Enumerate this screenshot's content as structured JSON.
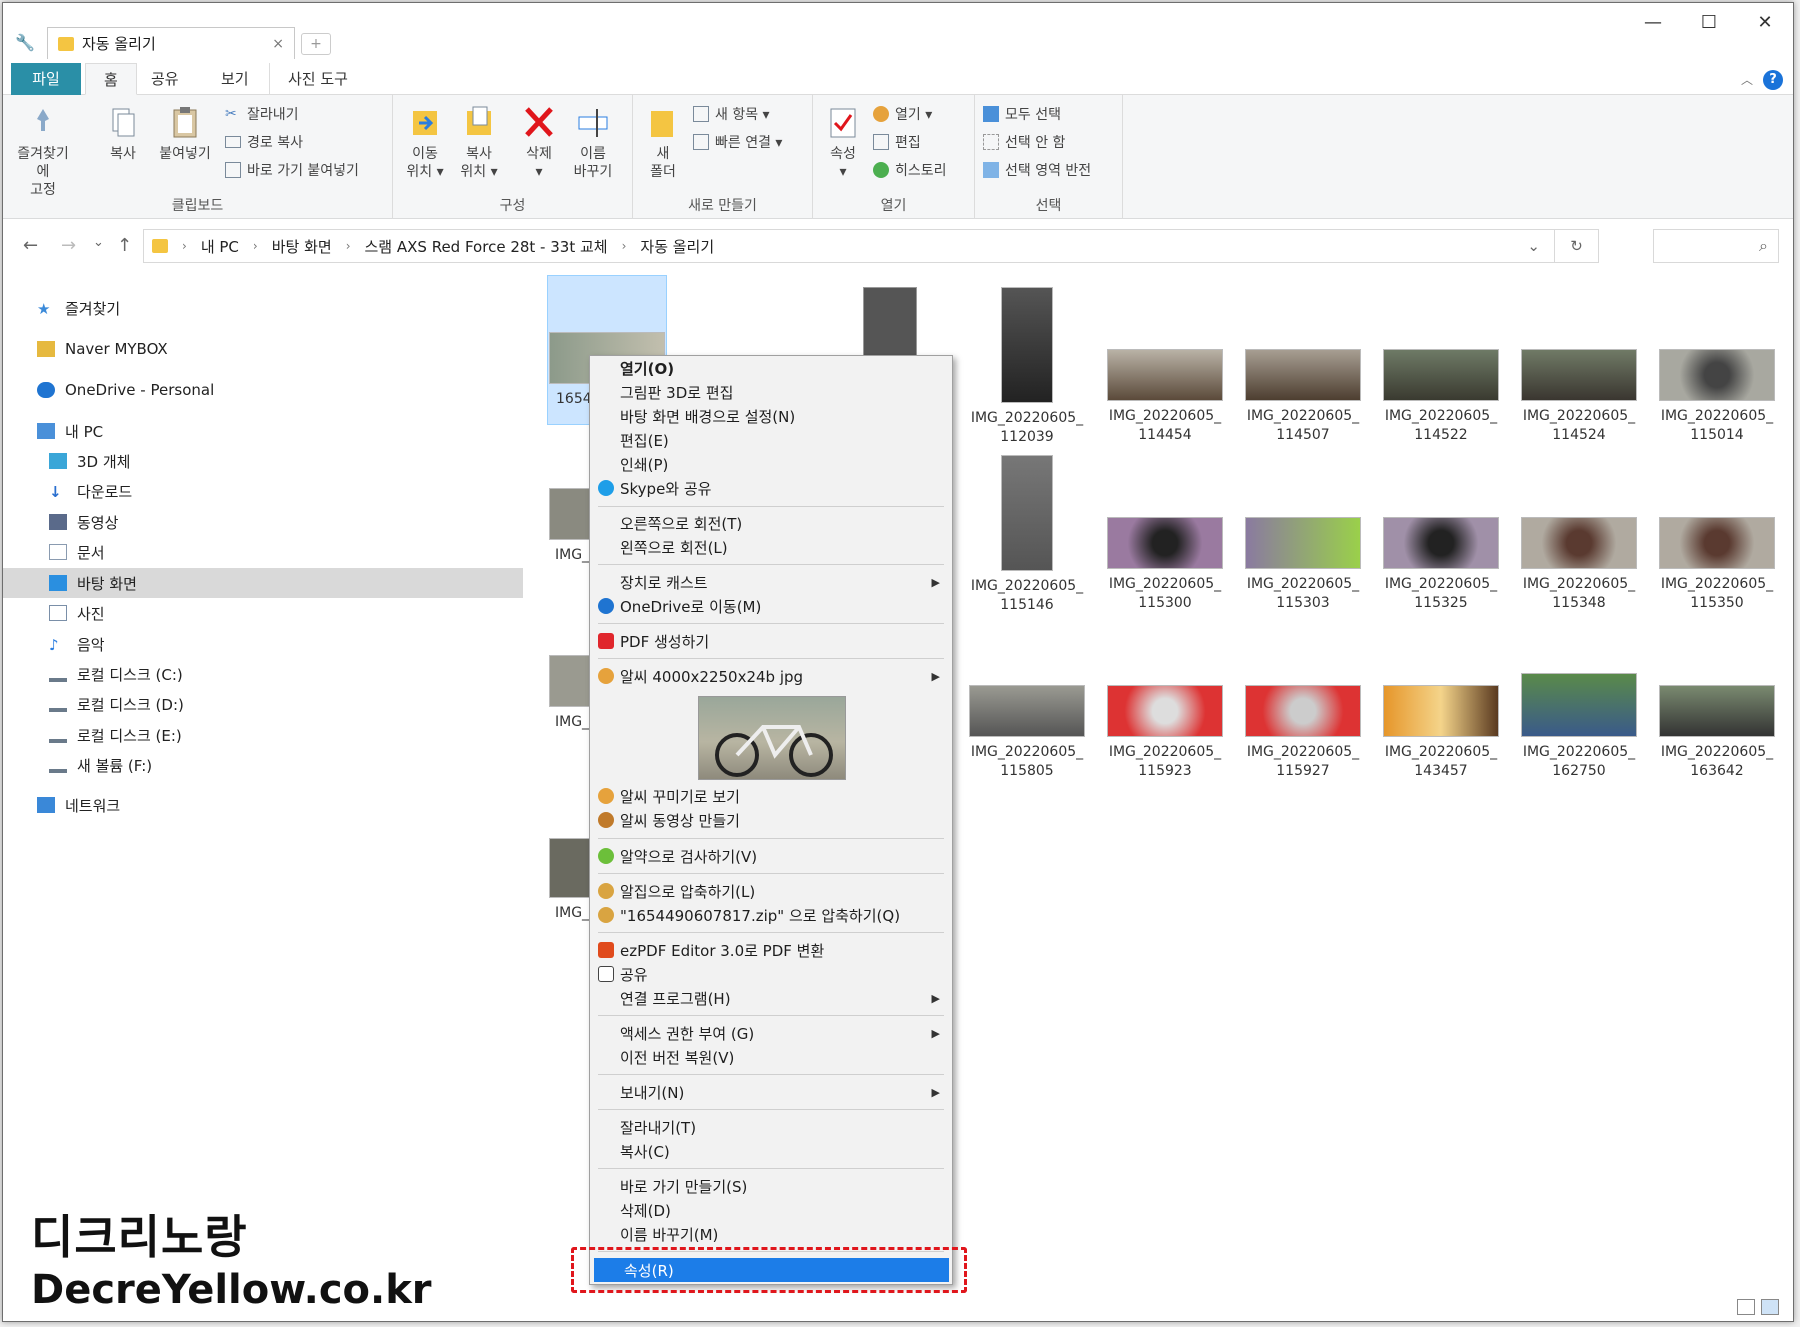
{
  "window": {
    "tab_title": "자동 올리기",
    "controls": {
      "minimize": "—",
      "maximize": "☐",
      "close": "✕"
    }
  },
  "menubar": {
    "tabs": [
      "파일",
      "홈",
      "공유",
      "보기",
      "사진 도구"
    ],
    "help": "?"
  },
  "ribbon": {
    "clipboard": {
      "label": "클립보드",
      "pin_line1": "즐겨찾기에",
      "pin_line2": "고정",
      "copy": "복사",
      "paste": "붙여넣기",
      "cut": "잘라내기",
      "copy_path": "경로 복사",
      "paste_shortcut": "바로 가기 붙여넣기"
    },
    "organize": {
      "label": "구성",
      "move_line1": "이동",
      "move_line2": "위치 ▾",
      "copyto_line1": "복사",
      "copyto_line2": "위치 ▾",
      "delete": "삭제",
      "delete_arrow": "▾",
      "rename_line1": "이름",
      "rename_line2": "바꾸기"
    },
    "new": {
      "label": "새로 만들기",
      "folder_line1": "새",
      "folder_line2": "폴더",
      "new_item": "새 항목 ▾",
      "easy_access": "빠른 연결 ▾"
    },
    "open": {
      "label": "열기",
      "properties": "속성",
      "properties_arrow": "▾",
      "open": "열기 ▾",
      "edit": "편집",
      "history": "히스토리"
    },
    "select": {
      "label": "선택",
      "select_all": "모두 선택",
      "select_none": "선택 안 함",
      "invert": "선택 영역 반전"
    }
  },
  "address": {
    "crumbs": [
      "내 PC",
      "바탕 화면",
      "스램 AXS Red Force 28t - 33t 교체",
      "자동 올리기"
    ],
    "back": "←",
    "forward": "→",
    "recent": "⌄",
    "up": "↑",
    "dropdown": "⌄",
    "refresh": "↻",
    "search_icon": "⌕"
  },
  "nav": {
    "items": [
      {
        "label": "즐겨찾기",
        "icon": "star-icon",
        "color": "#3b8ad9"
      },
      {
        "label": "Naver MYBOX",
        "icon": "mybox-icon",
        "color": "#e6b93f"
      },
      {
        "label": "OneDrive - Personal",
        "icon": "cloud-icon",
        "color": "#1f74d1"
      },
      {
        "label": "내 PC",
        "icon": "pc-icon",
        "color": "#4a90d9"
      },
      {
        "label": "3D 개체",
        "icon": "cube-icon",
        "color": "#3aa6d8"
      },
      {
        "label": "다운로드",
        "icon": "download-icon",
        "color": "#2a6fcf"
      },
      {
        "label": "동영상",
        "icon": "video-icon",
        "color": "#5a6a8a"
      },
      {
        "label": "문서",
        "icon": "document-icon",
        "color": "#8a9bb0"
      },
      {
        "label": "바탕 화면",
        "icon": "desktop-icon",
        "color": "#2a8fe0"
      },
      {
        "label": "사진",
        "icon": "picture-icon",
        "color": "#7a8fa8"
      },
      {
        "label": "음악",
        "icon": "music-icon",
        "color": "#2a7de0"
      },
      {
        "label": "로컬 디스크 (C:)",
        "icon": "drive-icon",
        "color": "#6a7a8a"
      },
      {
        "label": "로컬 디스크 (D:)",
        "icon": "drive-icon",
        "color": "#6a7a8a"
      },
      {
        "label": "로컬 디스크 (E:)",
        "icon": "drive-icon",
        "color": "#6a7a8a"
      },
      {
        "label": "새 볼륨 (F:)",
        "icon": "drive-icon",
        "color": "#6a7a8a"
      },
      {
        "label": "네트워크",
        "icon": "network-icon",
        "color": "#3a88d8"
      }
    ]
  },
  "files": [
    {
      "l1": "1654",
      "l2": ""
    },
    {
      "l1": "IMG_20220605_",
      "l2": "112039"
    },
    {
      "l1": "IMG_20220605_",
      "l2": "114454"
    },
    {
      "l1": "IMG_20220605_",
      "l2": "114507"
    },
    {
      "l1": "IMG_20220605_",
      "l2": "114522"
    },
    {
      "l1": "IMG_20220605_",
      "l2": "114524"
    },
    {
      "l1": "IMG_20220605_",
      "l2": "115014"
    },
    {
      "l1": "IMG_",
      "l2": ""
    },
    {
      "l1": "IMG_20220605_",
      "l2": "115146"
    },
    {
      "l1": "IMG_20220605_",
      "l2": "115300"
    },
    {
      "l1": "IMG_20220605_",
      "l2": "115303"
    },
    {
      "l1": "IMG_20220605_",
      "l2": "115325"
    },
    {
      "l1": "IMG_20220605_",
      "l2": "115348"
    },
    {
      "l1": "IMG_20220605_",
      "l2": "115350"
    },
    {
      "l1": "IMG_",
      "l2": ""
    },
    {
      "l1": "IMG_20220605_",
      "l2": "115805"
    },
    {
      "l1": "IMG_20220605_",
      "l2": "115923"
    },
    {
      "l1": "IMG_20220605_",
      "l2": "115927"
    },
    {
      "l1": "IMG_20220605_",
      "l2": "143457"
    },
    {
      "l1": "IMG_20220605_",
      "l2": "162750"
    },
    {
      "l1": "IMG_20220605_",
      "l2": "163642"
    },
    {
      "l1": "IMG_",
      "l2": ""
    }
  ],
  "context_menu": {
    "open": "열기(O)",
    "paint3d": "그림판 3D로 편집",
    "set_wallpaper": "바탕 화면 배경으로 설정(N)",
    "edit": "편집(E)",
    "print": "인쇄(P)",
    "skype": "Skype와 공유",
    "rotate_right": "오른쪽으로 회전(T)",
    "rotate_left": "왼쪽으로 회전(L)",
    "cast": "장치로 캐스트",
    "onedrive": "OneDrive로 이동(M)",
    "pdf": "PDF 생성하기",
    "alsee": "알씨 4000x2250x24b jpg",
    "alsee_decorate": "알씨 꾸미기로 보기",
    "alsee_video": "알씨 동영상 만들기",
    "alyac": "알약으로 검사하기(V)",
    "alzip": "알집으로 압축하기(L)",
    "alzip_named": "\"1654490607817.zip\" 으로 압축하기(Q)",
    "ezpdf": "ezPDF Editor 3.0로 PDF 변환",
    "share": "공유",
    "open_with": "연결 프로그램(H)",
    "grant_access": "액세스 권한 부여 (G)",
    "restore": "이전 버전 복원(V)",
    "send_to": "보내기(N)",
    "cut": "잘라내기(T)",
    "copy": "복사(C)",
    "shortcut": "바로 가기 만들기(S)",
    "delete": "삭제(D)",
    "rename": "이름 바꾸기(M)",
    "properties": "속성(R)",
    "submenu_arrow": "▶"
  },
  "watermark": {
    "line1": "디크리노랑",
    "line2": "DecreYellow.co.kr"
  },
  "colors": {
    "file_tab": "#2a8fa7",
    "highlight": "#1c7de8",
    "dash": "#e0161c"
  }
}
